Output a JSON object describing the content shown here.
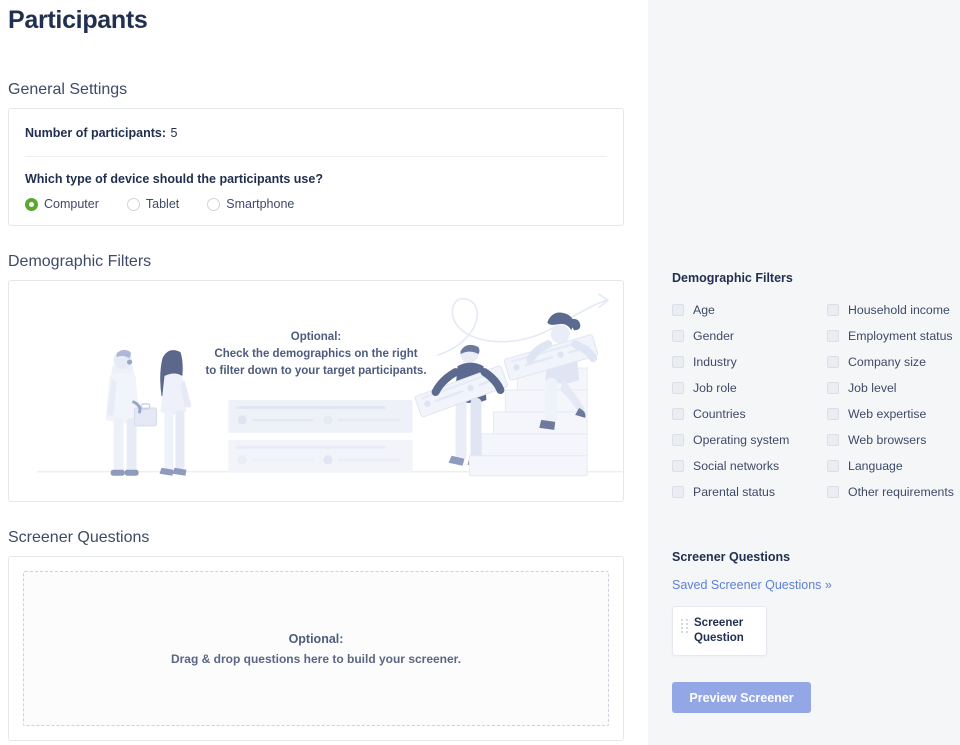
{
  "page": {
    "title": "Participants"
  },
  "general_settings": {
    "heading": "General Settings",
    "participants_label": "Number of participants:",
    "participants_value": "5",
    "device_question": "Which type of device should the participants use?",
    "device_options": [
      {
        "label": "Computer",
        "selected": true
      },
      {
        "label": "Tablet",
        "selected": false
      },
      {
        "label": "Smartphone",
        "selected": false
      }
    ]
  },
  "demographic_filters": {
    "heading": "Demographic Filters",
    "illustration_text": [
      "Optional:",
      "Check the demographics on the right",
      "to filter down to your target participants."
    ]
  },
  "screener_questions": {
    "heading": "Screener Questions",
    "dropzone_line1": "Optional:",
    "dropzone_line2": "Drag & drop questions here to build your screener."
  },
  "sidebar": {
    "demographic_filters": {
      "heading": "Demographic Filters",
      "items": [
        {
          "label": "Age",
          "checked": false
        },
        {
          "label": "Household income",
          "checked": false
        },
        {
          "label": "Gender",
          "checked": false
        },
        {
          "label": "Employment status",
          "checked": false
        },
        {
          "label": "Industry",
          "checked": false
        },
        {
          "label": "Company size",
          "checked": false
        },
        {
          "label": "Job role",
          "checked": false
        },
        {
          "label": "Job level",
          "checked": false
        },
        {
          "label": "Countries",
          "checked": false
        },
        {
          "label": "Web expertise",
          "checked": false
        },
        {
          "label": "Operating system",
          "checked": false
        },
        {
          "label": "Web browsers",
          "checked": false
        },
        {
          "label": "Social networks",
          "checked": false
        },
        {
          "label": "Language",
          "checked": false
        },
        {
          "label": "Parental status",
          "checked": false
        },
        {
          "label": "Other requirements",
          "checked": false
        }
      ]
    },
    "screener": {
      "heading": "Screener Questions",
      "saved_link": "Saved Screener Questions »",
      "chip_line1": "Screener",
      "chip_line2": "Question",
      "preview_button": "Preview Screener"
    }
  },
  "colors": {
    "accent_green": "#5aa832",
    "link_blue": "#5d80d8",
    "button_periwinkle": "#93a6e6",
    "text_navy": "#22304f",
    "sidebar_bg": "#f5f6f8"
  }
}
